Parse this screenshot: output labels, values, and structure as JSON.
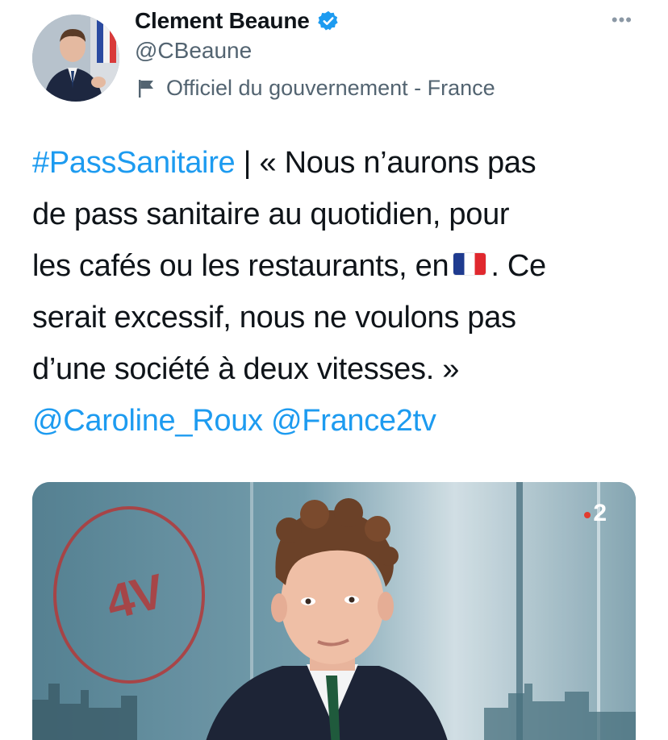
{
  "author": {
    "display_name": "Clement Beaune",
    "handle": "@CBeaune",
    "affiliation": "Officiel du gouvernement - France"
  },
  "more_label": "•••",
  "tweet": {
    "hashtag": "#PassSanitaire",
    "line1_rest": " | « Nous n’aurons pas",
    "line2": "de pass sanitaire au quotidien, pour",
    "line3_before_flag": "les cafés ou les restaurants, en",
    "line3_after_flag": ". Ce",
    "line4": "serait excessif, nous ne voulons pas",
    "line5": "d’une société à deux vitesses. »",
    "mention1": "@Caroline_Roux",
    "mention2": "@France2tv"
  },
  "media": {
    "channel_number": "2",
    "stamp_text": "4V"
  },
  "colors": {
    "link": "#1d9bf0",
    "secondary_text": "#536471",
    "verified": "#1d9bf0"
  },
  "icons": {
    "verified": "verified-badge-icon",
    "affiliation": "flag-icon",
    "more": "more-icon"
  }
}
